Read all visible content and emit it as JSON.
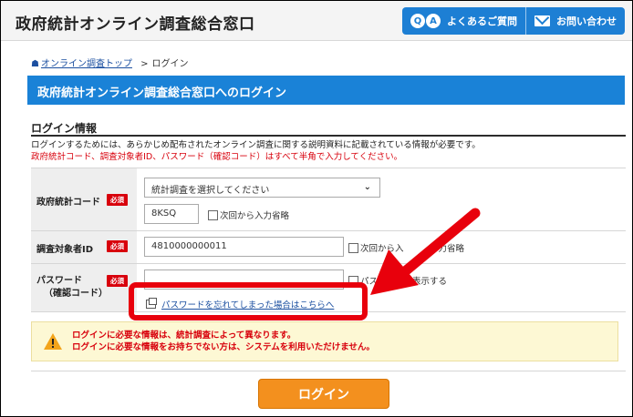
{
  "header": {
    "site_title": "政府統計オンライン調査総合窓口",
    "faq_label": "よくあるご質問",
    "contact_label": "お問い合わせ",
    "qa_letters": [
      "Q",
      "A"
    ]
  },
  "breadcrumb": {
    "home_icon": "home-icon",
    "top_link": "オンライン調査トップ",
    "separator": ">",
    "current": "ログイン"
  },
  "page_title": "政府統計オンライン調査総合窓口へのログイン",
  "section_heading": "ログイン情報",
  "description": {
    "line1": "ログインするためには、あらかじめ配布されたオンライン調査に関する説明資料に記載されている情報が必要です。",
    "line2": "政府統計コード、調査対象者ID、パスワード（確認コード）はすべて半角で入力してください。"
  },
  "form": {
    "required_badge": "必須",
    "stat_code": {
      "label": "政府統計コード",
      "select_value": "統計調査を選択してください",
      "code_value": "8KSQ",
      "skip_label": "次回から入力省略"
    },
    "respondent_id": {
      "label": "調査対象者ID",
      "value": "4810000000011",
      "skip_label_visible": "次回から入",
      "skip_label_tail": "力省略"
    },
    "password": {
      "label_line1": "パスワード",
      "label_line2": "（確認コード）",
      "value": "",
      "show_label_head": "パス",
      "show_label_tail": "ワードを表示する",
      "forgot_link": "パスワードを忘れてしまった場合はこちらへ"
    }
  },
  "warning": {
    "line1": "ログインに必要な情報は、統計調査によって異なります。",
    "line2": "ログインに必要な情報をお持ちでない方は、システムを利用いただけません。"
  },
  "login_button": "ログイン",
  "colors": {
    "brand_blue": "#1a82d7",
    "required_red": "#d8000c",
    "login_orange": "#f3901e",
    "annotation_red": "#e8000c"
  }
}
